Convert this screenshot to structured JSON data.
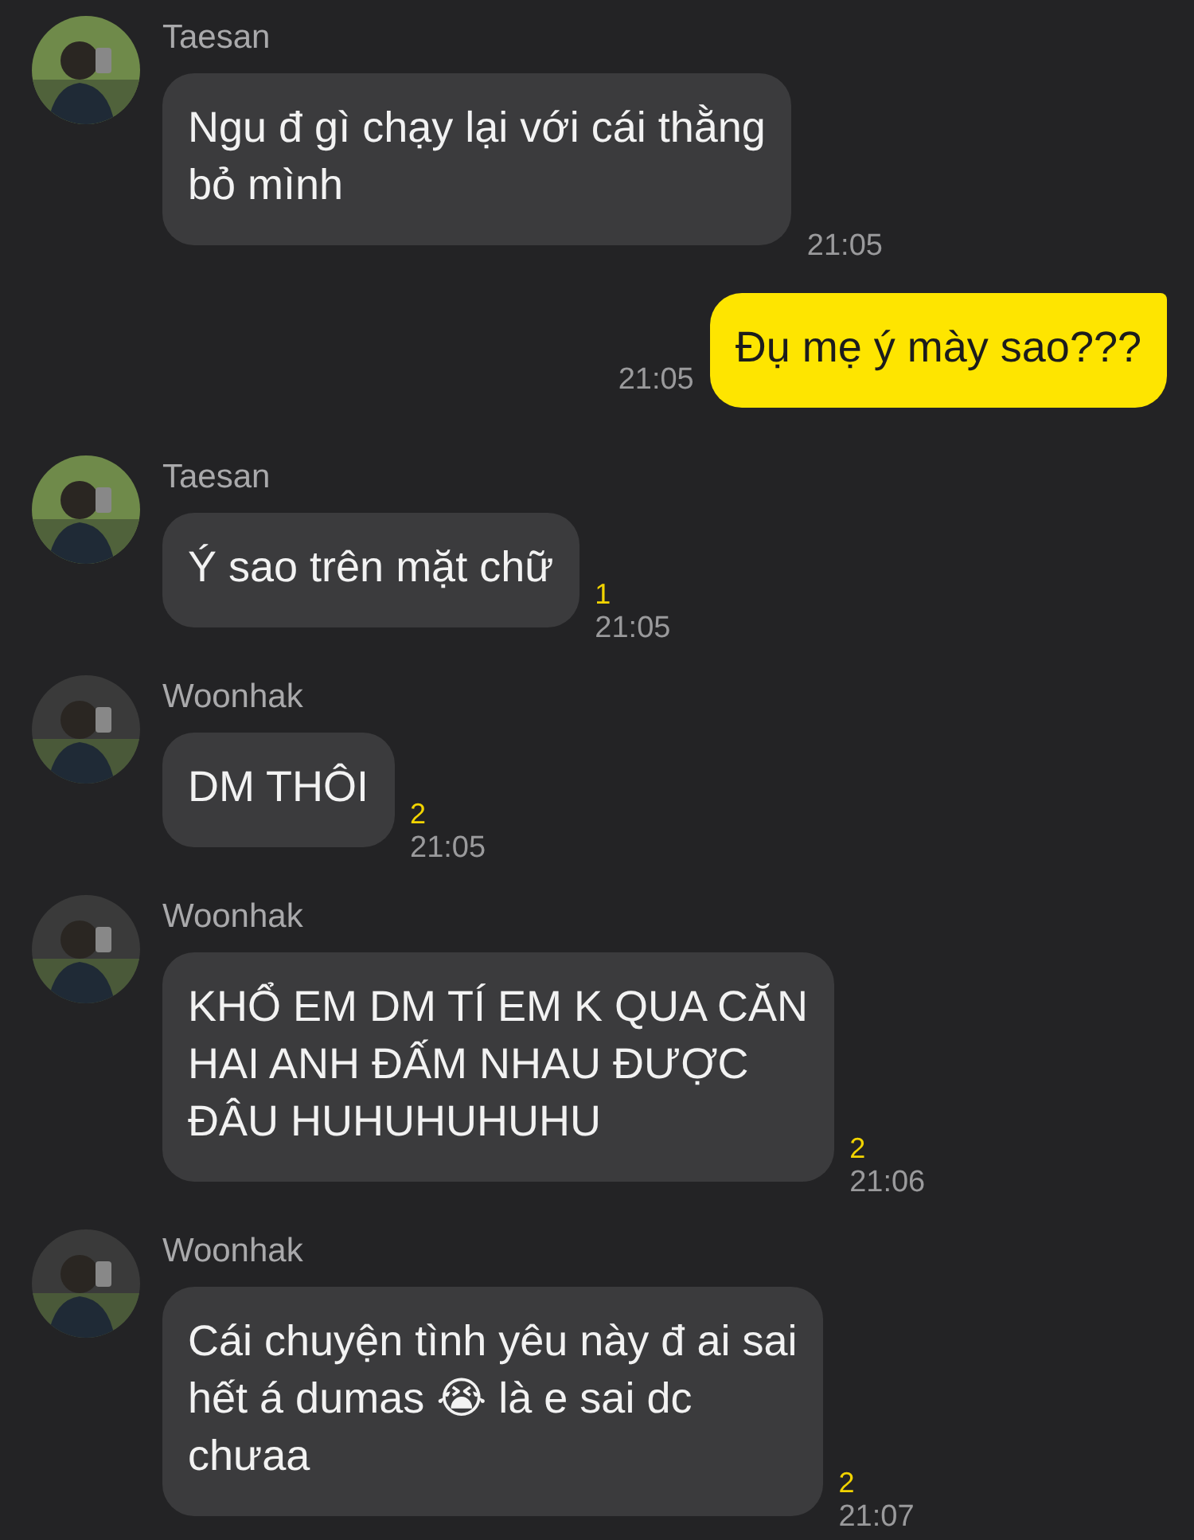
{
  "messages": [
    {
      "kind": "incoming",
      "sender": "Taesan",
      "text": "Ngu đ gì chạy lại với cái thằng\nbỏ mình",
      "time": "21:05"
    },
    {
      "kind": "outgoing",
      "text": "Đụ mẹ ý mày sao???",
      "time": "21:05"
    },
    {
      "kind": "incoming",
      "sender": "Taesan",
      "text": "Ý sao trên mặt chữ",
      "unread": "1",
      "time": "21:05"
    },
    {
      "kind": "incoming",
      "sender": "Woonhak",
      "text": "DM THÔI",
      "unread": "2",
      "time": "21:05"
    },
    {
      "kind": "incoming",
      "sender": "Woonhak",
      "text": "KHỔ EM DM TÍ EM K QUA CĂN\nHAI ANH ĐẤM NHAU ĐƯỢC\nĐÂU HUHUHUHUHU",
      "unread": "2",
      "time": "21:06"
    },
    {
      "kind": "incoming",
      "sender": "Woonhak",
      "text": "Cái chuyện tình yêu này đ ai sai\nhết á dumas 😭 là e sai dc\nchưaa",
      "unread": "2",
      "time": "21:07"
    }
  ]
}
